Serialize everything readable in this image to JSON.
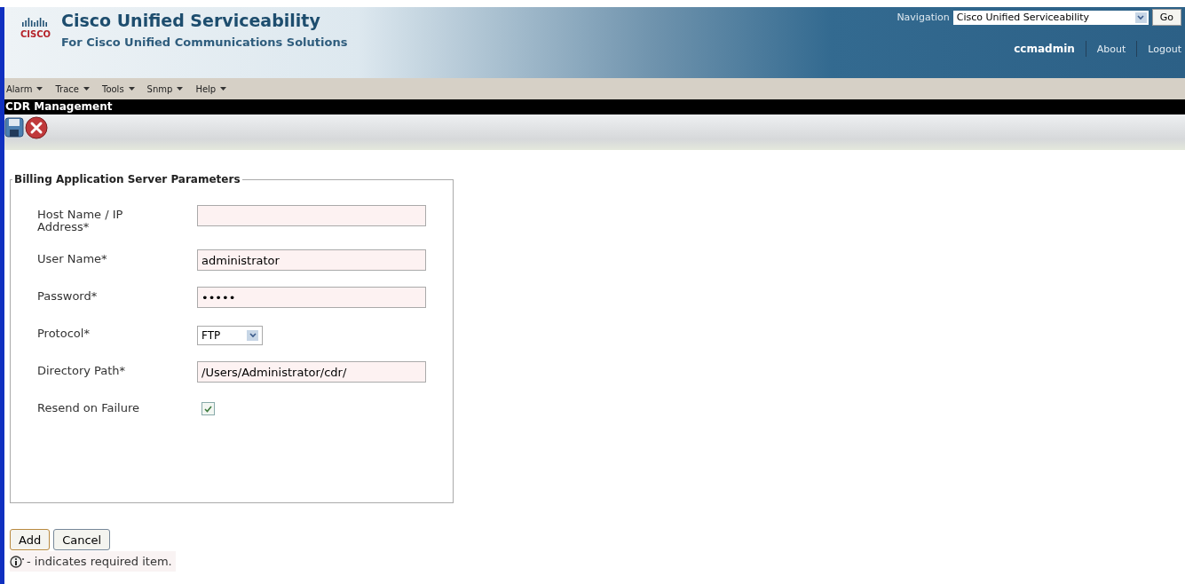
{
  "header": {
    "title": "Cisco Unified Serviceability",
    "subtitle": "For Cisco Unified Communications Solutions",
    "logo_text": "CISCO",
    "navigation": {
      "label": "Navigation",
      "value": "Cisco Unified Serviceability",
      "button": "Go"
    },
    "user": "ccmadmin",
    "links": [
      "About",
      "Logout"
    ]
  },
  "menu": [
    {
      "label": "Alarm"
    },
    {
      "label": "Trace"
    },
    {
      "label": "Tools"
    },
    {
      "label": "Snmp"
    },
    {
      "label": "Help"
    }
  ],
  "page_title": "CDR Management",
  "fieldset": {
    "legend": "Billing Application Server Parameters",
    "fields": [
      {
        "kind": "text",
        "label": "Host Name / IP Address*"
      },
      {
        "kind": "text",
        "label": "User Name*",
        "value": "administrator"
      },
      {
        "kind": "text",
        "label": "Password*",
        "value": "•••••"
      },
      {
        "kind": "select",
        "label": "Protocol*",
        "value": "FTP"
      },
      {
        "kind": "text",
        "label": "Directory Path*",
        "value": "/Users/Administrator/cdr/"
      },
      {
        "kind": "checkbox",
        "label": "Resend on Failure",
        "checked": true
      }
    ]
  },
  "buttons": [
    "Add",
    "Cancel"
  ],
  "note": "- indicates required item."
}
